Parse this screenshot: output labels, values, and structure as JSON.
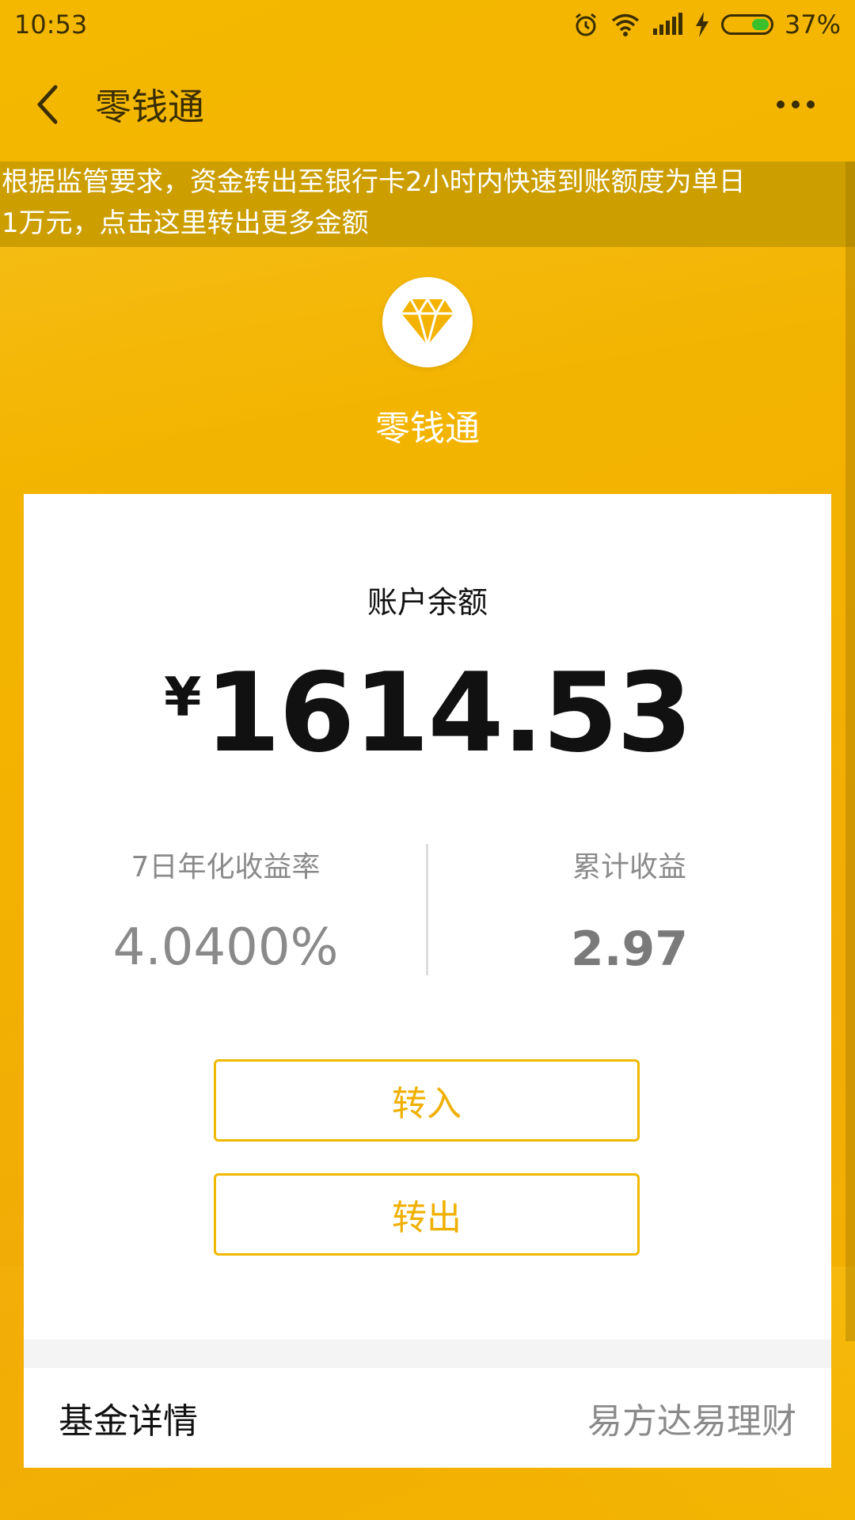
{
  "status_bar": {
    "time": "10:53",
    "battery_percent": "37%",
    "battery_level": 0.37,
    "icons": [
      "alarm-icon",
      "wifi-icon",
      "signal-icon",
      "charging-icon",
      "battery-icon"
    ]
  },
  "nav": {
    "title": "零钱通",
    "back_icon": "chevron-left-icon",
    "more_icon": "more-dots-icon"
  },
  "notice": {
    "line1": "根据监管要求，资金转出至银行卡2小时内快速到账额度为单日",
    "line2": "1万元，点击这里转出更多金额"
  },
  "product": {
    "name": "零钱通",
    "logo_icon": "diamond-icon"
  },
  "balance": {
    "label": "账户余额",
    "currency": "¥",
    "amount": "1614.53"
  },
  "stats": {
    "yield_label": "7日年化收益率",
    "yield_value": "4.0400%",
    "earnings_label": "累计收益",
    "earnings_value": "2.97"
  },
  "actions": {
    "transfer_in": "转入",
    "transfer_out": "转出"
  },
  "fund": {
    "label": "基金详情",
    "value": "易方达易理财"
  },
  "colors": {
    "background": "#f3b300",
    "accent": "#f0b800",
    "notice_bg": "#cc9e00",
    "text_dark": "#111111",
    "text_gray": "#8a8a8a"
  }
}
